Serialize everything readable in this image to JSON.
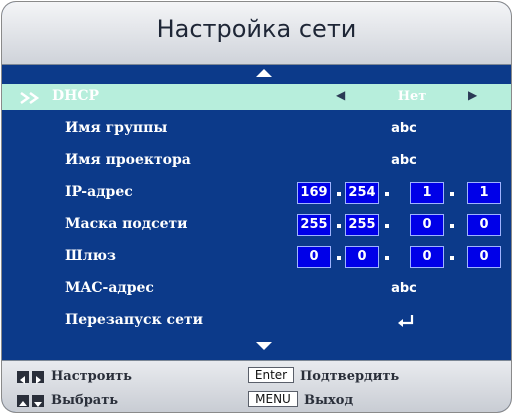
{
  "title": "Настройка сети",
  "rows": {
    "dhcp": {
      "label": "DHCP",
      "value": "Нет"
    },
    "group_name": {
      "label": "Имя группы",
      "value": "abc"
    },
    "projector_name": {
      "label": "Имя проектора",
      "value": "abc"
    },
    "ip_address": {
      "label": "IP-адрес",
      "octets": [
        "169",
        "254",
        "1",
        "1"
      ]
    },
    "subnet_mask": {
      "label": "Маска подсети",
      "octets": [
        "255",
        "255",
        "0",
        "0"
      ]
    },
    "gateway": {
      "label": "Шлюз",
      "octets": [
        "0",
        "0",
        "0",
        "0"
      ]
    },
    "mac_address": {
      "label": "MAC-адрес",
      "value": "abc"
    },
    "network_restart": {
      "label": "Перезапуск сети"
    }
  },
  "footer": {
    "adjust_label": "Настроить",
    "select_label": "Выбрать",
    "enter_key": "Enter",
    "confirm_label": "Подтвердить",
    "menu_key": "MENU",
    "exit_label": "Выход"
  },
  "colors": {
    "panel": "#0c3a8a",
    "highlight": "#b7eedc",
    "ip_field": "#0000e8"
  },
  "icons": {
    "selection": "double-chevron-right-icon",
    "restart": "enter-return-icon",
    "scroll_up": "triangle-up-icon",
    "scroll_down": "triangle-down-icon"
  }
}
